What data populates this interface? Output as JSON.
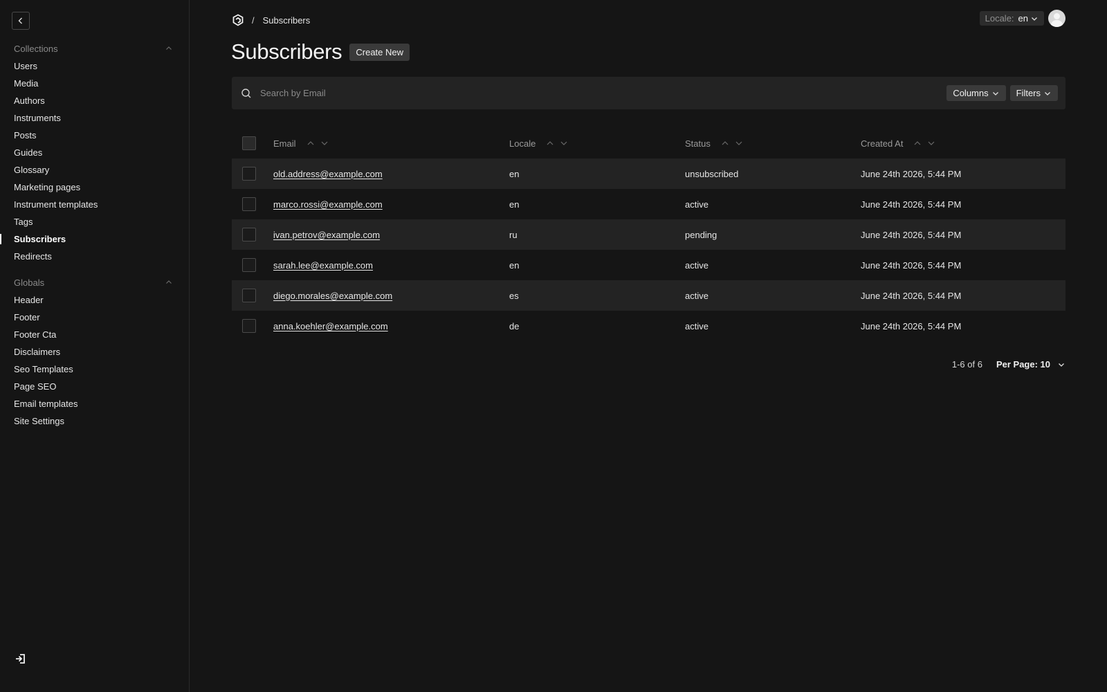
{
  "sidebar": {
    "collections_label": "Collections",
    "collections": [
      {
        "label": "Users"
      },
      {
        "label": "Media"
      },
      {
        "label": "Authors"
      },
      {
        "label": "Instruments"
      },
      {
        "label": "Posts"
      },
      {
        "label": "Guides"
      },
      {
        "label": "Glossary"
      },
      {
        "label": "Marketing pages"
      },
      {
        "label": "Instrument templates"
      },
      {
        "label": "Tags"
      },
      {
        "label": "Subscribers"
      },
      {
        "label": "Redirects"
      }
    ],
    "active_item": "Subscribers",
    "globals_label": "Globals",
    "globals": [
      {
        "label": "Header"
      },
      {
        "label": "Footer"
      },
      {
        "label": "Footer Cta"
      },
      {
        "label": "Disclaimers"
      },
      {
        "label": "Seo Templates"
      },
      {
        "label": "Page SEO"
      },
      {
        "label": "Email templates"
      },
      {
        "label": "Site Settings"
      }
    ]
  },
  "header": {
    "breadcrumb_separator": "/",
    "breadcrumb_current": "Subscribers",
    "locale_label": "Locale:",
    "locale_value": "en"
  },
  "page": {
    "title": "Subscribers",
    "create_button": "Create New"
  },
  "search": {
    "placeholder": "Search by Email",
    "value": "",
    "columns_button": "Columns",
    "filters_button": "Filters"
  },
  "table": {
    "headers": {
      "email": "Email",
      "locale": "Locale",
      "status": "Status",
      "created_at": "Created At"
    },
    "rows": [
      {
        "email": "old.address@example.com",
        "locale": "en",
        "status": "unsubscribed",
        "created_at": "June 24th 2026, 5:44 PM"
      },
      {
        "email": "marco.rossi@example.com",
        "locale": "en",
        "status": "active",
        "created_at": "June 24th 2026, 5:44 PM"
      },
      {
        "email": "ivan.petrov@example.com",
        "locale": "ru",
        "status": "pending",
        "created_at": "June 24th 2026, 5:44 PM"
      },
      {
        "email": "sarah.lee@example.com",
        "locale": "en",
        "status": "active",
        "created_at": "June 24th 2026, 5:44 PM"
      },
      {
        "email": "diego.morales@example.com",
        "locale": "es",
        "status": "active",
        "created_at": "June 24th 2026, 5:44 PM"
      },
      {
        "email": "anna.koehler@example.com",
        "locale": "de",
        "status": "active",
        "created_at": "June 24th 2026, 5:44 PM"
      }
    ]
  },
  "pagination": {
    "info": "1-6 of 6",
    "per_page": "Per Page: 10"
  },
  "colors": {
    "background": "#151515",
    "surface": "#232323",
    "button": "#3a3a3a",
    "text": "#ebebeb",
    "muted": "#8a8a8a"
  }
}
